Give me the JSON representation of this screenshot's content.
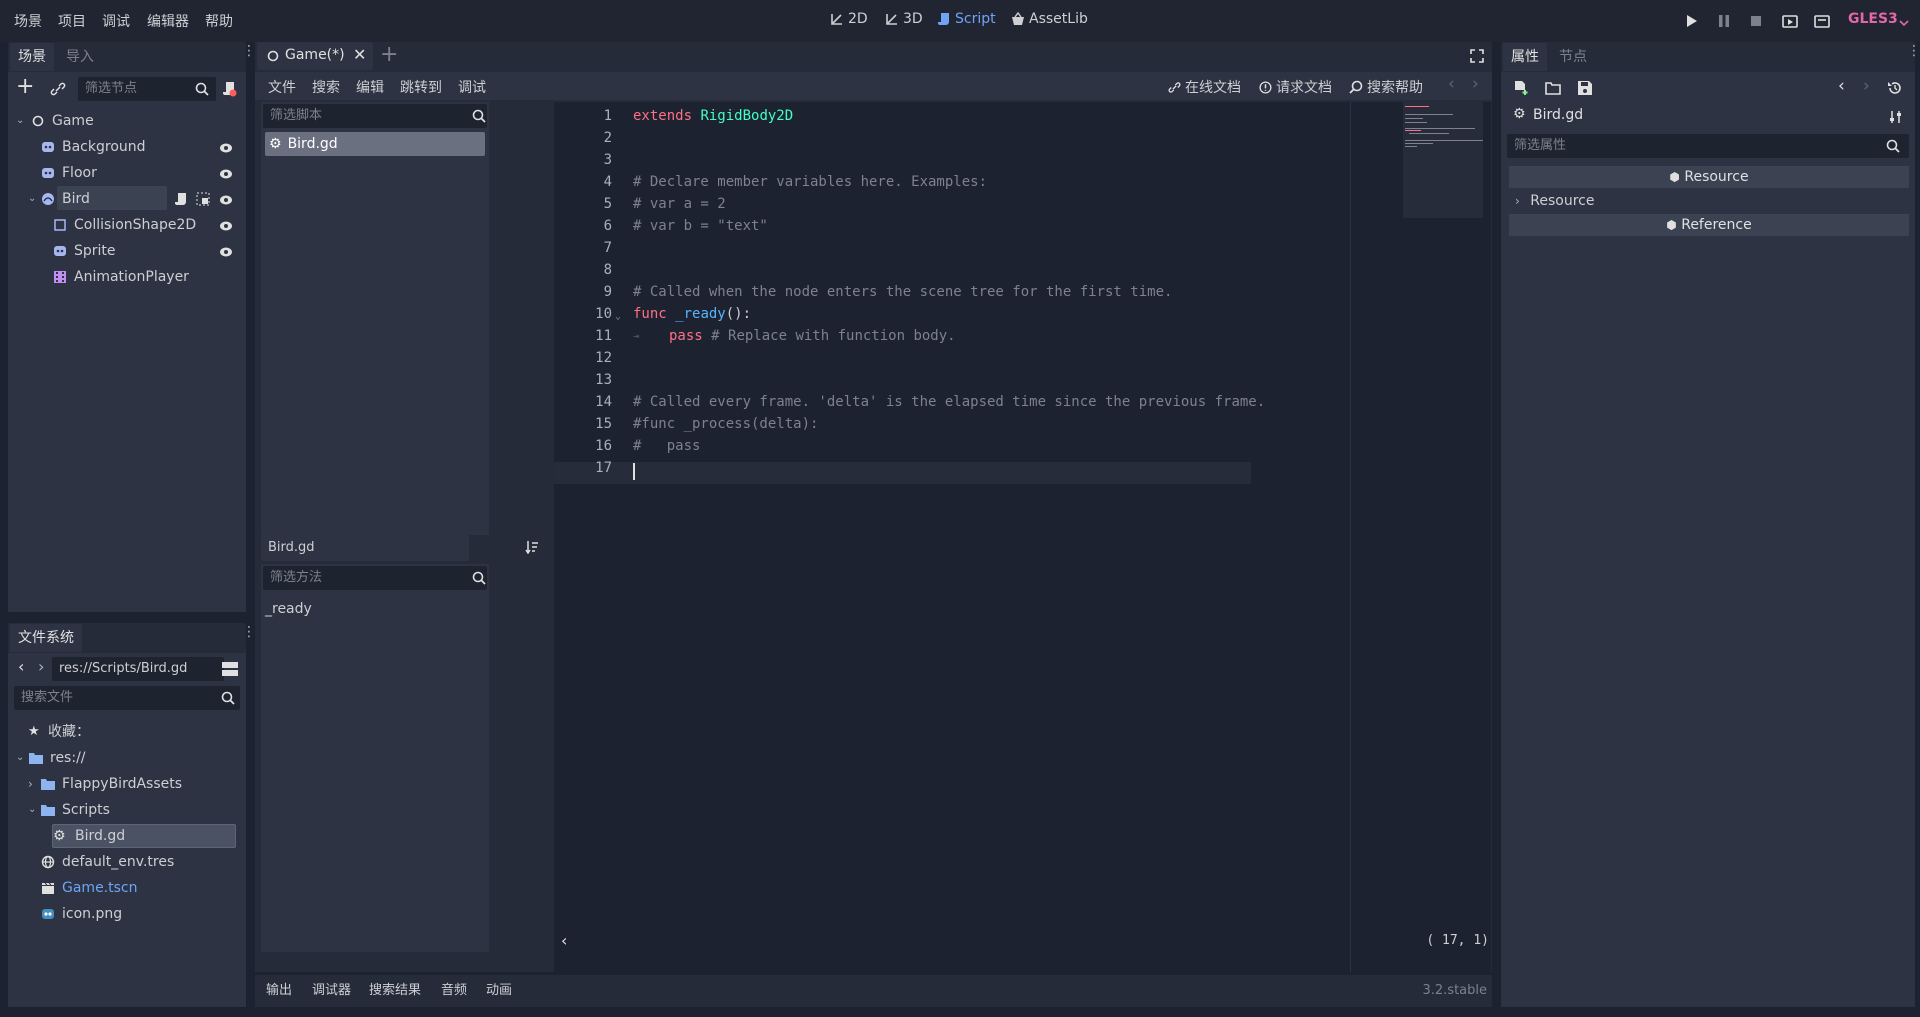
{
  "menu": {
    "scene": "场景",
    "project": "项目",
    "debug": "调试",
    "editor": "编辑器",
    "help": "帮助"
  },
  "workspaces": {
    "w2d": "2D",
    "w3d": "3D",
    "script": "Script",
    "assetlib": "AssetLib"
  },
  "renderer": "GLES3",
  "colors": {
    "accent": "#6fa4f4",
    "renderer": "#e366a9",
    "keyword": "#ff7085",
    "type": "#42ffc2",
    "function": "#57b3ff",
    "comment": "#7d8190",
    "string": "#ffeda1"
  },
  "scene_dock": {
    "tabs": [
      "场景",
      "导入"
    ],
    "filter_placeholder": "筛选节点",
    "nodes": [
      {
        "name": "Game",
        "icon": "node2d-icon"
      },
      {
        "name": "Background",
        "icon": "sprite-icon"
      },
      {
        "name": "Floor",
        "icon": "sprite-icon"
      },
      {
        "name": "Bird",
        "icon": "rigidbody-icon"
      },
      {
        "name": "CollisionShape2D",
        "icon": "collision-icon"
      },
      {
        "name": "Sprite",
        "icon": "sprite-icon"
      },
      {
        "name": "AnimationPlayer",
        "icon": "animation-icon"
      }
    ]
  },
  "fs_dock": {
    "title": "文件系统",
    "path": "res://Scripts/Bird.gd",
    "search_placeholder": "搜索文件",
    "items": {
      "favorites": "收藏：",
      "res": "res://",
      "flappy": "FlappyBirdAssets",
      "scripts": "Scripts",
      "birdgd": "Bird.gd",
      "env": "default_env.tres",
      "game": "Game.tscn",
      "icon": "icon.png"
    }
  },
  "editor_tab": {
    "label": "Game(*)"
  },
  "script_menu": {
    "file": "文件",
    "search": "搜索",
    "edit": "编辑",
    "goto": "跳转到",
    "debug": "调试",
    "online_docs": "在线文档",
    "request_docs": "请求文档",
    "search_help": "搜索帮助"
  },
  "script_list": {
    "filter_placeholder": "筛选脚本",
    "items": [
      "Bird.gd"
    ]
  },
  "method_panel": {
    "title": "Bird.gd",
    "filter_placeholder": "筛选方法",
    "items": [
      "_ready"
    ]
  },
  "code": {
    "line_numbers": [
      "1",
      "2",
      "3",
      "4",
      "5",
      "6",
      "7",
      "8",
      "9",
      "10",
      "11",
      "12",
      "13",
      "14",
      "15",
      "16",
      "17"
    ],
    "l1_kw": "extends",
    "l1_type": "RigidBody2D",
    "l4": "# Declare member variables here. Examples:",
    "l5": "# var a = 2",
    "l6": "# var b = \"text\"",
    "l9": "# Called when the node enters the scene tree for the first time.",
    "l10_kw": "func",
    "l10_fn": "_ready",
    "l10_rest": "():",
    "l11_kw": "pass",
    "l11_cm": "# Replace with function body.",
    "l14": "# Called every frame. 'delta' is the elapsed time since the previous frame.",
    "l15": "#func _process(delta):",
    "l16": "#\tpass",
    "cursor_pos": "( 17,  1)"
  },
  "inspector": {
    "tabs": [
      "属性",
      "节点"
    ],
    "resource_name": "Bird.gd",
    "filter_placeholder": "筛选属性",
    "section_resource": "Resource",
    "prop_resource": "Resource",
    "section_reference": "Reference"
  },
  "bottom_panel": {
    "output": "输出",
    "debugger": "调试器",
    "search_results": "搜索结果",
    "audio": "音频",
    "animation": "动画",
    "version": "3.2.stable"
  }
}
